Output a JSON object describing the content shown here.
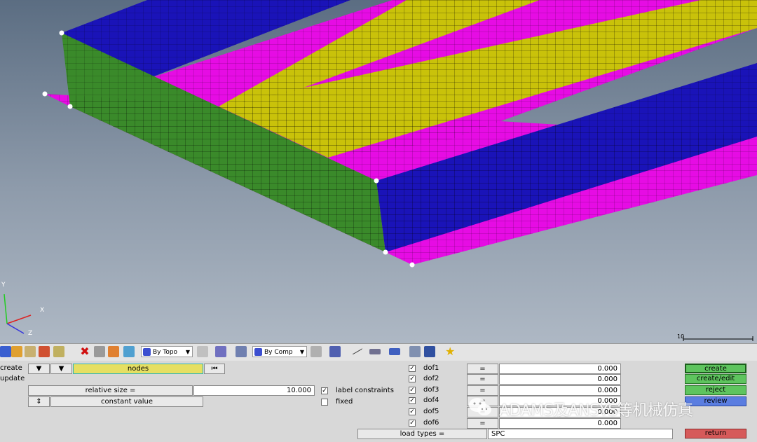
{
  "viewport": {
    "axes": {
      "x": "X",
      "y": "Y",
      "z": "Z"
    },
    "scale_label": "10",
    "colors": {
      "blue": "#1a13b8",
      "magenta": "#e60ce4",
      "yellow": "#c9c20a",
      "green": "#3a8a2a"
    }
  },
  "toolbar": {
    "topo_dropdown": "By Topo",
    "comp_dropdown": "By Comp"
  },
  "panel": {
    "radio_create": "create",
    "radio_update": "update",
    "entity_selector": "nodes",
    "relative_size_label": "relative size =",
    "relative_size_value": "10.000",
    "constant_value_label": "constant value",
    "label_constraints": "label constraints",
    "fixed": "fixed",
    "dofs": [
      {
        "label": "dof1",
        "eq": "=",
        "value": "0.000",
        "checked": true
      },
      {
        "label": "dof2",
        "eq": "=",
        "value": "0.000",
        "checked": true
      },
      {
        "label": "dof3",
        "eq": "=",
        "value": "0.000",
        "checked": true
      },
      {
        "label": "dof4",
        "eq": "=",
        "value": "0.000",
        "checked": true
      },
      {
        "label": "dof5",
        "eq": "=",
        "value": "0.000",
        "checked": true
      },
      {
        "label": "dof6",
        "eq": "=",
        "value": "0.000",
        "checked": true
      }
    ],
    "load_types_label": "load types =",
    "load_types_value": "SPC",
    "create_btn": "create",
    "create_edit_btn": "create/edit",
    "reject_btn": "reject",
    "review_btn": "review",
    "return_btn": "return"
  },
  "watermark": "ADAMS及ANSYS等机械仿真"
}
